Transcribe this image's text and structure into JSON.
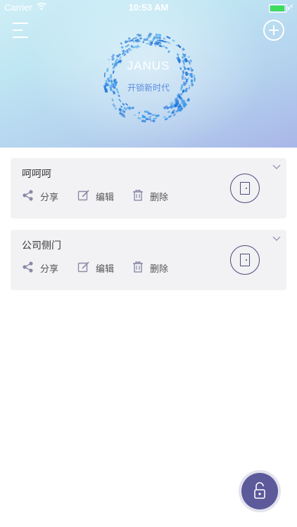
{
  "status_bar": {
    "carrier": "Carrier",
    "time": "10:53 AM"
  },
  "header": {
    "menu_icon": "menu-icon",
    "add_icon": "plus-circle-icon",
    "brand": "JANUS",
    "slogan": "开锁新时代"
  },
  "locks": [
    {
      "name": "呵呵呵",
      "share_label": "分享",
      "edit_label": "编辑",
      "delete_label": "删除"
    },
    {
      "name": "公司侧门",
      "share_label": "分享",
      "edit_label": "编辑",
      "delete_label": "删除"
    }
  ],
  "fab": {
    "icon": "unlock-icon"
  },
  "colors": {
    "accent": "#5c5a9a",
    "slogan": "#5b8de0",
    "card_bg": "#f2f2f5"
  }
}
